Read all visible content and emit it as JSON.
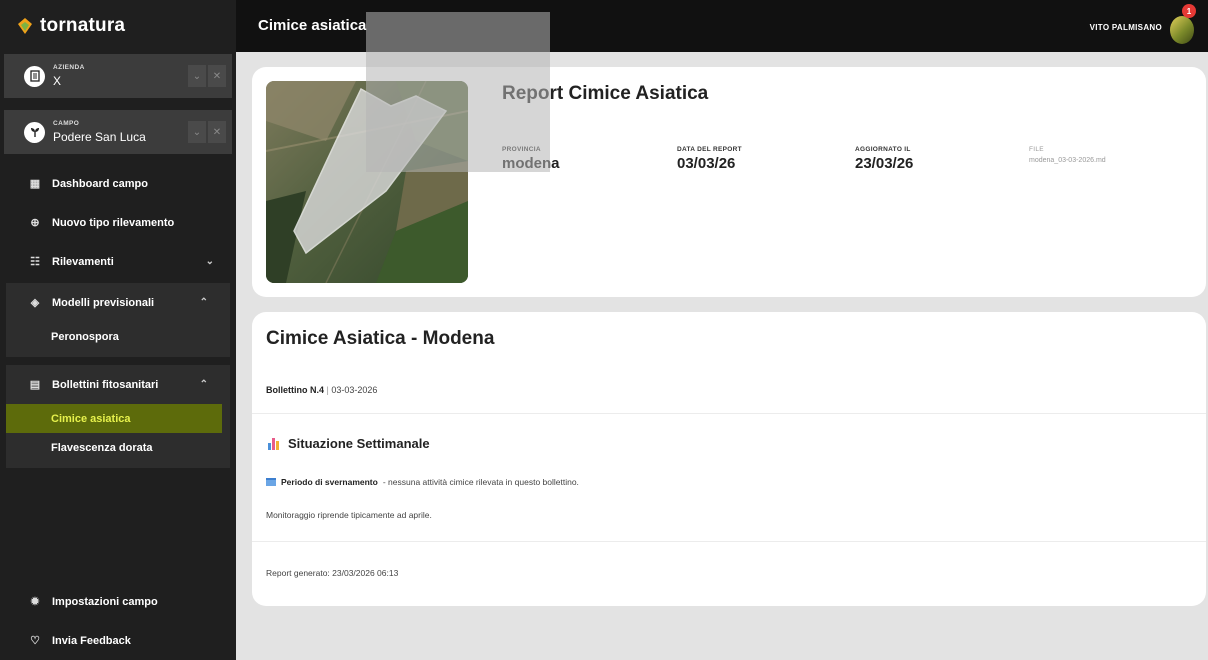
{
  "brand": {
    "name": "tornatura"
  },
  "selectors": {
    "azienda": {
      "label": "AZIENDA",
      "value": "X"
    },
    "campo": {
      "label": "CAMPO",
      "value": "Podere San Luca"
    }
  },
  "nav": {
    "dashboard": "Dashboard campo",
    "nuovo": "Nuovo tipo rilevamento",
    "rilevamenti": "Rilevamenti",
    "modelli": {
      "label": "Modelli previsionali",
      "items": [
        "Peronospora"
      ]
    },
    "bollettini": {
      "label": "Bollettini fitosanitari",
      "items": [
        "Cimice asiatica",
        "Flavescenza dorata"
      ]
    },
    "impostazioni": "Impostazioni campo",
    "feedback": "Invia Feedback"
  },
  "topbar": {
    "title": "Cimice asiatica",
    "user": "VITO PALMISANO",
    "notifications": "1"
  },
  "report": {
    "title": "Report Cimice Asiatica",
    "provincia_label": "PROVINCIA",
    "provincia": "modena",
    "data_label": "DATA DEL REPORT",
    "data": "03/03/26",
    "aggiornato_label": "AGGIORNATO IL",
    "aggiornato": "23/03/26",
    "file_label": "FILE",
    "file": "modena_03-03-2026.md"
  },
  "bulletin": {
    "title": "Cimice Asiatica - Modena",
    "number": "Bollettino N.4",
    "separator": "|",
    "date": "03-03-2026",
    "section_title": "Situazione Settimanale",
    "period_bold": "Periodo di svernamento",
    "period_text": "- nessuna attività cimice rilevata in questo bollettino.",
    "monitoring": "Monitoraggio riprende tipicamente ad aprile.",
    "generated": "Report generato: 23/03/2026 06:13"
  },
  "colors": {
    "accent": "#e6f14c",
    "active_bg": "#5d6b0b",
    "sidebar": "#1f1f1f",
    "topbar": "#111111"
  }
}
